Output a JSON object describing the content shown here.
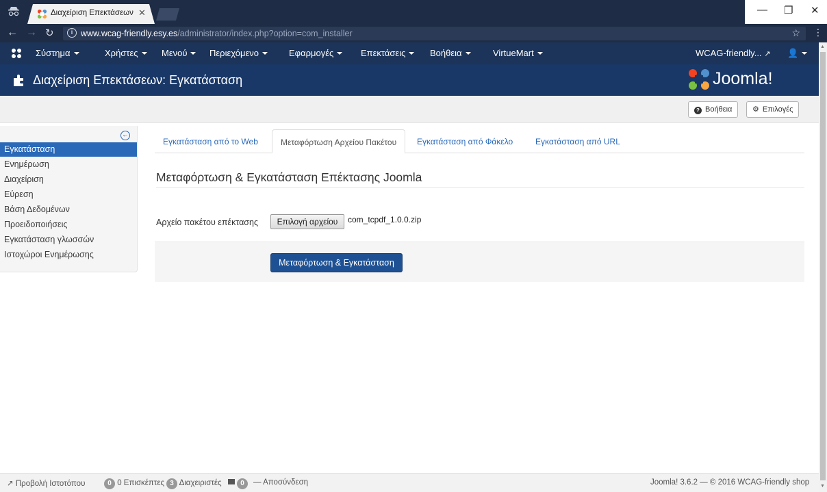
{
  "browser": {
    "tab_title": "Διαχείριση Επεκτάσεων",
    "url_host": "www.wcag-friendly.esy.es",
    "url_path": "/administrator/index.php?option=com_installer"
  },
  "topnav": {
    "items": [
      "Σύστημα",
      "Χρήστες",
      "Μενού",
      "Περιεχόμενο",
      "Εφαρμογές",
      "Επεκτάσεις",
      "Βοήθεια",
      "VirtueMart"
    ],
    "site_link": "WCAG-friendly..."
  },
  "header": {
    "title": "Διαχείριση Επεκτάσεων: Εγκατάσταση",
    "logo_text": "Joomla!"
  },
  "toolbar": {
    "help_label": "Βοήθεια",
    "options_label": "Επιλογές"
  },
  "sidebar": {
    "items": [
      {
        "label": "Εγκατάσταση",
        "active": true
      },
      {
        "label": "Ενημέρωση"
      },
      {
        "label": "Διαχείριση"
      },
      {
        "label": "Εύρεση"
      },
      {
        "label": "Βάση Δεδομένων"
      },
      {
        "label": "Προειδοποιήσεις"
      },
      {
        "label": "Εγκατάσταση γλωσσών"
      },
      {
        "label": "Ιστοχώροι Ενημέρωσης"
      }
    ]
  },
  "tabs": [
    {
      "label": "Εγκατάσταση από το Web"
    },
    {
      "label": "Μεταφόρτωση Αρχείου Πακέτου",
      "active": true
    },
    {
      "label": "Εγκατάσταση από Φάκελο"
    },
    {
      "label": "Εγκατάσταση από URL"
    }
  ],
  "form": {
    "legend": "Μεταφόρτωση & Εγκατάσταση Επέκτασης Joomla",
    "field_label": "Αρχείο πακέτου επέκτασης",
    "file_button": "Επιλογή αρχείου",
    "file_name": "com_tcpdf_1.0.0.zip",
    "submit_label": "Μεταφόρτωση & Εγκατάσταση"
  },
  "status": {
    "view_site": "Προβολή Ιστοτόπου",
    "visitors_count": "0",
    "visitors_label": "0 Επισκέπτες",
    "admins_count": "3",
    "admins_label": "Διαχειριστές",
    "messages_count": "0",
    "logout": "Αποσύνδεση",
    "version": "Joomla! 3.6.2 — © 2016 WCAG-friendly shop"
  },
  "colors": {
    "nav": "#1c3459",
    "header": "#1a3867",
    "accent": "#2a69b8",
    "primary_button": "#1e5193"
  }
}
